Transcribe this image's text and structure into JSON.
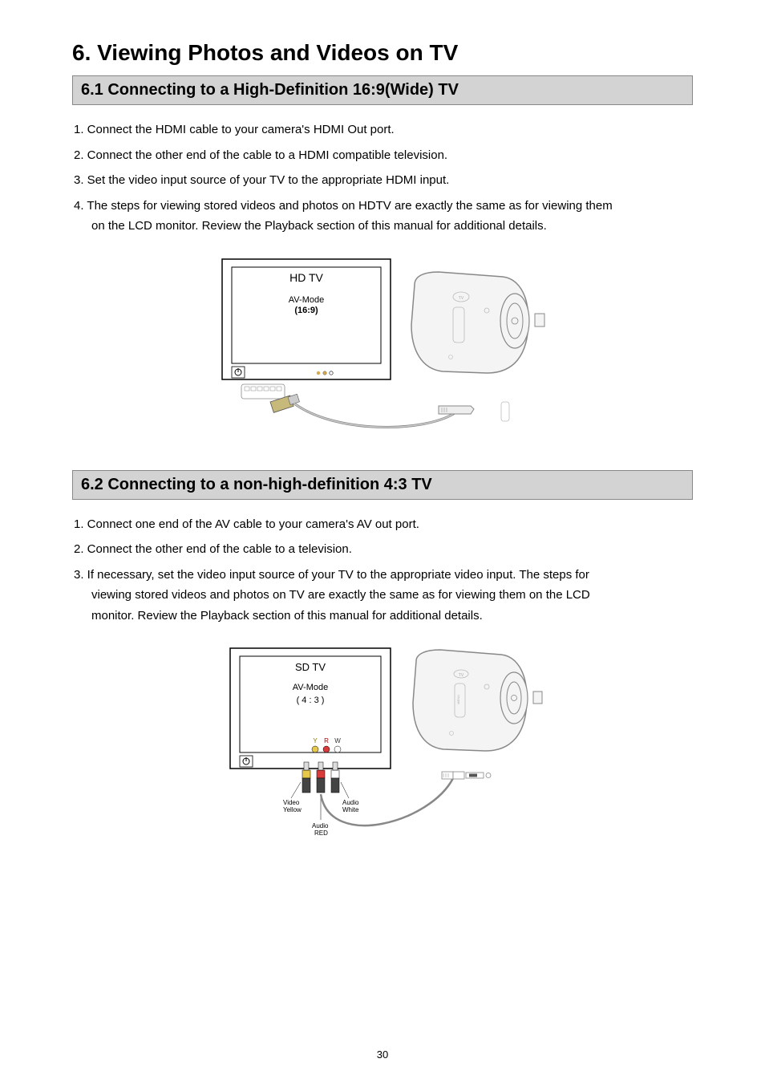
{
  "title": "6. Viewing Photos and Videos on TV",
  "section61": {
    "heading": "6.1 Connecting to a High-Definition 16:9(Wide) TV",
    "steps": [
      "1. Connect the HDMI cable to your camera's HDMI Out port.",
      "2. Connect the other end of the cable to a HDMI compatible television.",
      "3. Set the video input source of your TV to the appropriate HDMI input.",
      "4. The steps for viewing stored videos and photos on HDTV are exactly the same as for viewing them",
      "on the LCD monitor.  Review the Playback section of this manual for additional details."
    ],
    "figure": {
      "tv_label": "HD TV",
      "mode_label": "AV-Mode",
      "mode_ratio": "(16:9)"
    }
  },
  "section62": {
    "heading": "6.2 Connecting to a non-high-definition 4:3 TV",
    "steps": [
      "1. Connect one end of the AV cable to your camera's AV out port.",
      "2. Connect the other end of the cable to a television.",
      "3. If necessary, set the video input source of your TV to the appropriate video input. The steps for",
      "viewing stored videos and photos on TV are exactly the same as for viewing them on the LCD",
      "monitor. Review the Playback section of this manual for additional details."
    ],
    "figure": {
      "tv_label": "SD TV",
      "mode_label": "AV-Mode",
      "mode_ratio": "( 4 : 3 )",
      "rca": {
        "Y": "Y",
        "R": "R",
        "W": "W"
      },
      "labels": {
        "video_yellow_1": "Video",
        "video_yellow_2": "Yellow",
        "audio_white_1": "Audio",
        "audio_white_2": "White",
        "audio_red_1": "Audio",
        "audio_red_2": "RED"
      }
    }
  },
  "page_number": "30"
}
